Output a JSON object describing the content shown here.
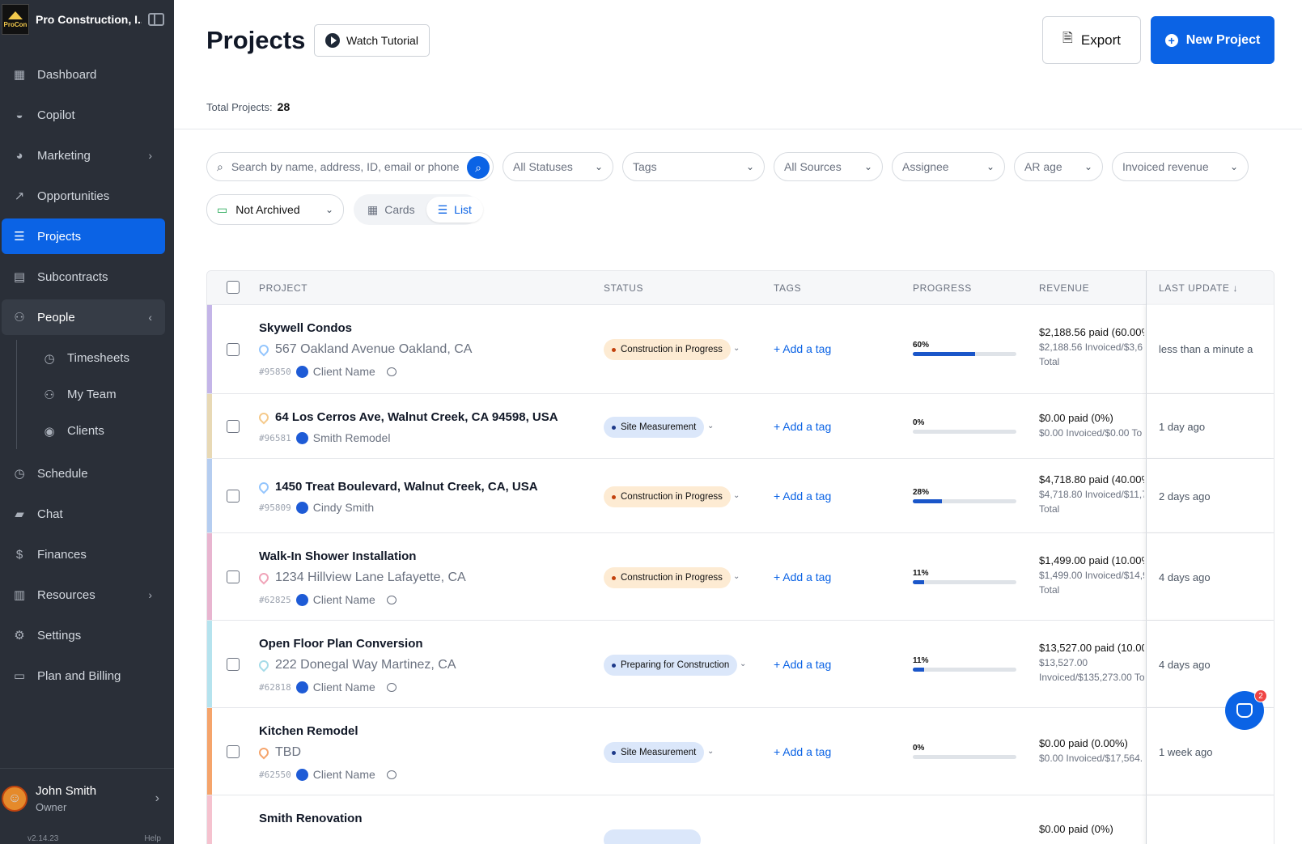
{
  "sidebar": {
    "company": "Pro Construction, I...",
    "logo_text": "ProCon",
    "items": [
      {
        "label": "Dashboard",
        "icon": "grid-icon"
      },
      {
        "label": "Copilot",
        "icon": "robot-icon"
      },
      {
        "label": "Marketing",
        "icon": "pie-chart-icon"
      },
      {
        "label": "Opportunities",
        "icon": "trend-icon"
      },
      {
        "label": "Projects",
        "icon": "list-icon"
      },
      {
        "label": "Subcontracts",
        "icon": "document-icon"
      },
      {
        "label": "People",
        "icon": "people-icon"
      }
    ],
    "people_sub": [
      {
        "label": "Timesheets",
        "icon": "stopwatch-icon"
      },
      {
        "label": "My Team",
        "icon": "team-icon"
      },
      {
        "label": "Clients",
        "icon": "user-circle-icon"
      }
    ],
    "items2": [
      {
        "label": "Schedule",
        "icon": "clock-icon"
      },
      {
        "label": "Chat",
        "icon": "chat-icon"
      },
      {
        "label": "Finances",
        "icon": "dollar-icon"
      },
      {
        "label": "Resources",
        "icon": "book-icon"
      },
      {
        "label": "Settings",
        "icon": "gear-icon"
      },
      {
        "label": "Plan and Billing",
        "icon": "card-icon"
      }
    ],
    "user": {
      "name": "John Smith",
      "role": "Owner"
    },
    "version": "v2.14.23",
    "help": "Help"
  },
  "header": {
    "title": "Projects",
    "tutorial": "Watch Tutorial",
    "export": "Export",
    "new_project": "New Project",
    "total_label": "Total Projects:",
    "total_value": "28"
  },
  "filters": {
    "search_placeholder": "Search by name, address, ID, email or phone",
    "statuses": "All Statuses",
    "tags": "Tags",
    "sources": "All Sources",
    "assignee": "Assignee",
    "ar_age": "AR age",
    "invoiced": "Invoiced revenue",
    "archived": "Not Archived",
    "view_cards": "Cards",
    "view_list": "List"
  },
  "table": {
    "headers": {
      "project": "PROJECT",
      "status": "STATUS",
      "tags": "TAGS",
      "progress": "PROGRESS",
      "revenue": "REVENUE",
      "last_update": "LAST UPDATE ↓"
    },
    "add_tag": "+ Add a tag",
    "rows": [
      {
        "name": "Skywell Condos",
        "address": "567 Oakland Avenue Oakland, CA",
        "id": "#95850",
        "client": "Client Name",
        "status": "Construction in Progress",
        "progress": "60%",
        "paid": "$2,188.56 paid (60.00%",
        "invoiced": "$2,188.56 Invoiced/$3,6",
        "total": "Total",
        "last": "less than a minute a",
        "stripe": "#c4b5e8"
      },
      {
        "address": "64 Los Cerros Ave, Walnut Creek, CA 94598, USA",
        "id": "#96581",
        "client": "Smith Remodel",
        "status": "Site Measurement",
        "progress": "0%",
        "paid": "$0.00 paid (0%)",
        "invoiced": "$0.00 Invoiced/$0.00 To",
        "last": "1 day ago",
        "stripe": "#e8d9b5"
      },
      {
        "address": "1450 Treat Boulevard, Walnut Creek, CA, USA",
        "id": "#95809",
        "client": "Cindy Smith",
        "status": "Construction in Progress",
        "progress": "28%",
        "paid": "$4,718.80 paid (40.00%",
        "invoiced": "$4,718.80 Invoiced/$11,7",
        "total": "Total",
        "last": "2 days ago",
        "stripe": "#b5cdf0"
      },
      {
        "name": "Walk-In Shower Installation",
        "address": "1234 Hillview Lane Lafayette, CA",
        "id": "#62825",
        "client": "Client Name",
        "status": "Construction in Progress",
        "progress": "11%",
        "paid": "$1,499.00 paid (10.00%",
        "invoiced": "$1,499.00 Invoiced/$14,9",
        "total": "Total",
        "last": "4 days ago",
        "stripe": "#e8b5d0"
      },
      {
        "name": "Open Floor Plan Conversion",
        "address": "222 Donegal Way Martinez, CA",
        "id": "#62818",
        "client": "Client Name",
        "status": "Preparing for Construction",
        "progress": "11%",
        "paid": "$13,527.00 paid (10.00'",
        "invoiced": "$13,527.00",
        "total": "Invoiced/$135,273.00 To",
        "last": "4 days ago",
        "stripe": "#b5e3ee"
      },
      {
        "name": "Kitchen Remodel",
        "address": "TBD",
        "id": "#62550",
        "client": "Client Name",
        "status": "Site Measurement",
        "progress": "0%",
        "paid": "$0.00 paid (0.00%)",
        "invoiced": "$0.00 Invoiced/$17,564.",
        "last": "1 week ago",
        "stripe": "#f5a46b"
      },
      {
        "name": "Smith Renovation",
        "paid": "$0.00 paid (0%)",
        "stripe": "#f5c2cf"
      }
    ]
  },
  "chat_badge": "2"
}
